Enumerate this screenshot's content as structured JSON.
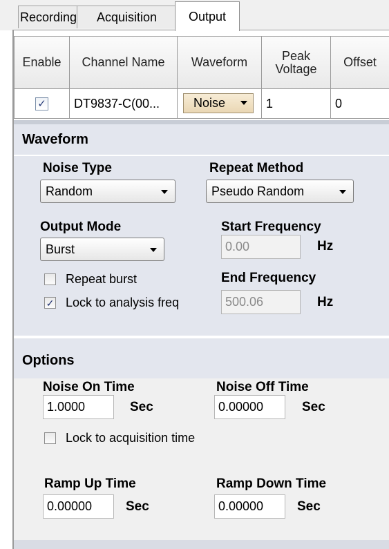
{
  "tabs": [
    {
      "label": "Recording",
      "active": false
    },
    {
      "label": "Acquisition",
      "active": false
    },
    {
      "label": "Output",
      "active": true
    }
  ],
  "grid": {
    "headers": [
      "Enable",
      "Channel Name",
      "Waveform",
      "Peak Voltage",
      "Offset"
    ],
    "row": {
      "enable_checked": true,
      "check_glyph": "✓",
      "channel_name": "DT9837-C(00...",
      "waveform": "Noise",
      "peak_voltage": "1",
      "offset": "0"
    }
  },
  "waveform_panel": {
    "title": "Waveform",
    "noise_type_label": "Noise Type",
    "noise_type_value": "Random",
    "repeat_method_label": "Repeat Method",
    "repeat_method_value": "Pseudo Random",
    "output_mode_label": "Output Mode",
    "output_mode_value": "Burst",
    "start_freq_label": "Start Frequency",
    "start_freq_value": "0.00",
    "end_freq_label": "End Frequency",
    "end_freq_value": "500.06",
    "hz": "Hz",
    "repeat_burst_label": "Repeat burst",
    "repeat_burst_checked": false,
    "lock_analysis_label": "Lock to analysis freq",
    "lock_analysis_checked": true
  },
  "options_panel": {
    "title": "Options",
    "noise_on_label": "Noise On Time",
    "noise_on_value": "1.0000",
    "noise_off_label": "Noise Off Time",
    "noise_off_value": "0.00000",
    "sec": "Sec",
    "lock_acq_label": "Lock to acquisition time",
    "lock_acq_checked": false,
    "ramp_up_label": "Ramp Up Time",
    "ramp_up_value": "0.00000",
    "ramp_down_label": "Ramp Down Time",
    "ramp_down_value": "0.00000"
  },
  "colors": {
    "panel_bg": "#e3e6ee",
    "options_bg": "#f0f0f0",
    "waveform_combo_bg": "#ead7b4"
  }
}
